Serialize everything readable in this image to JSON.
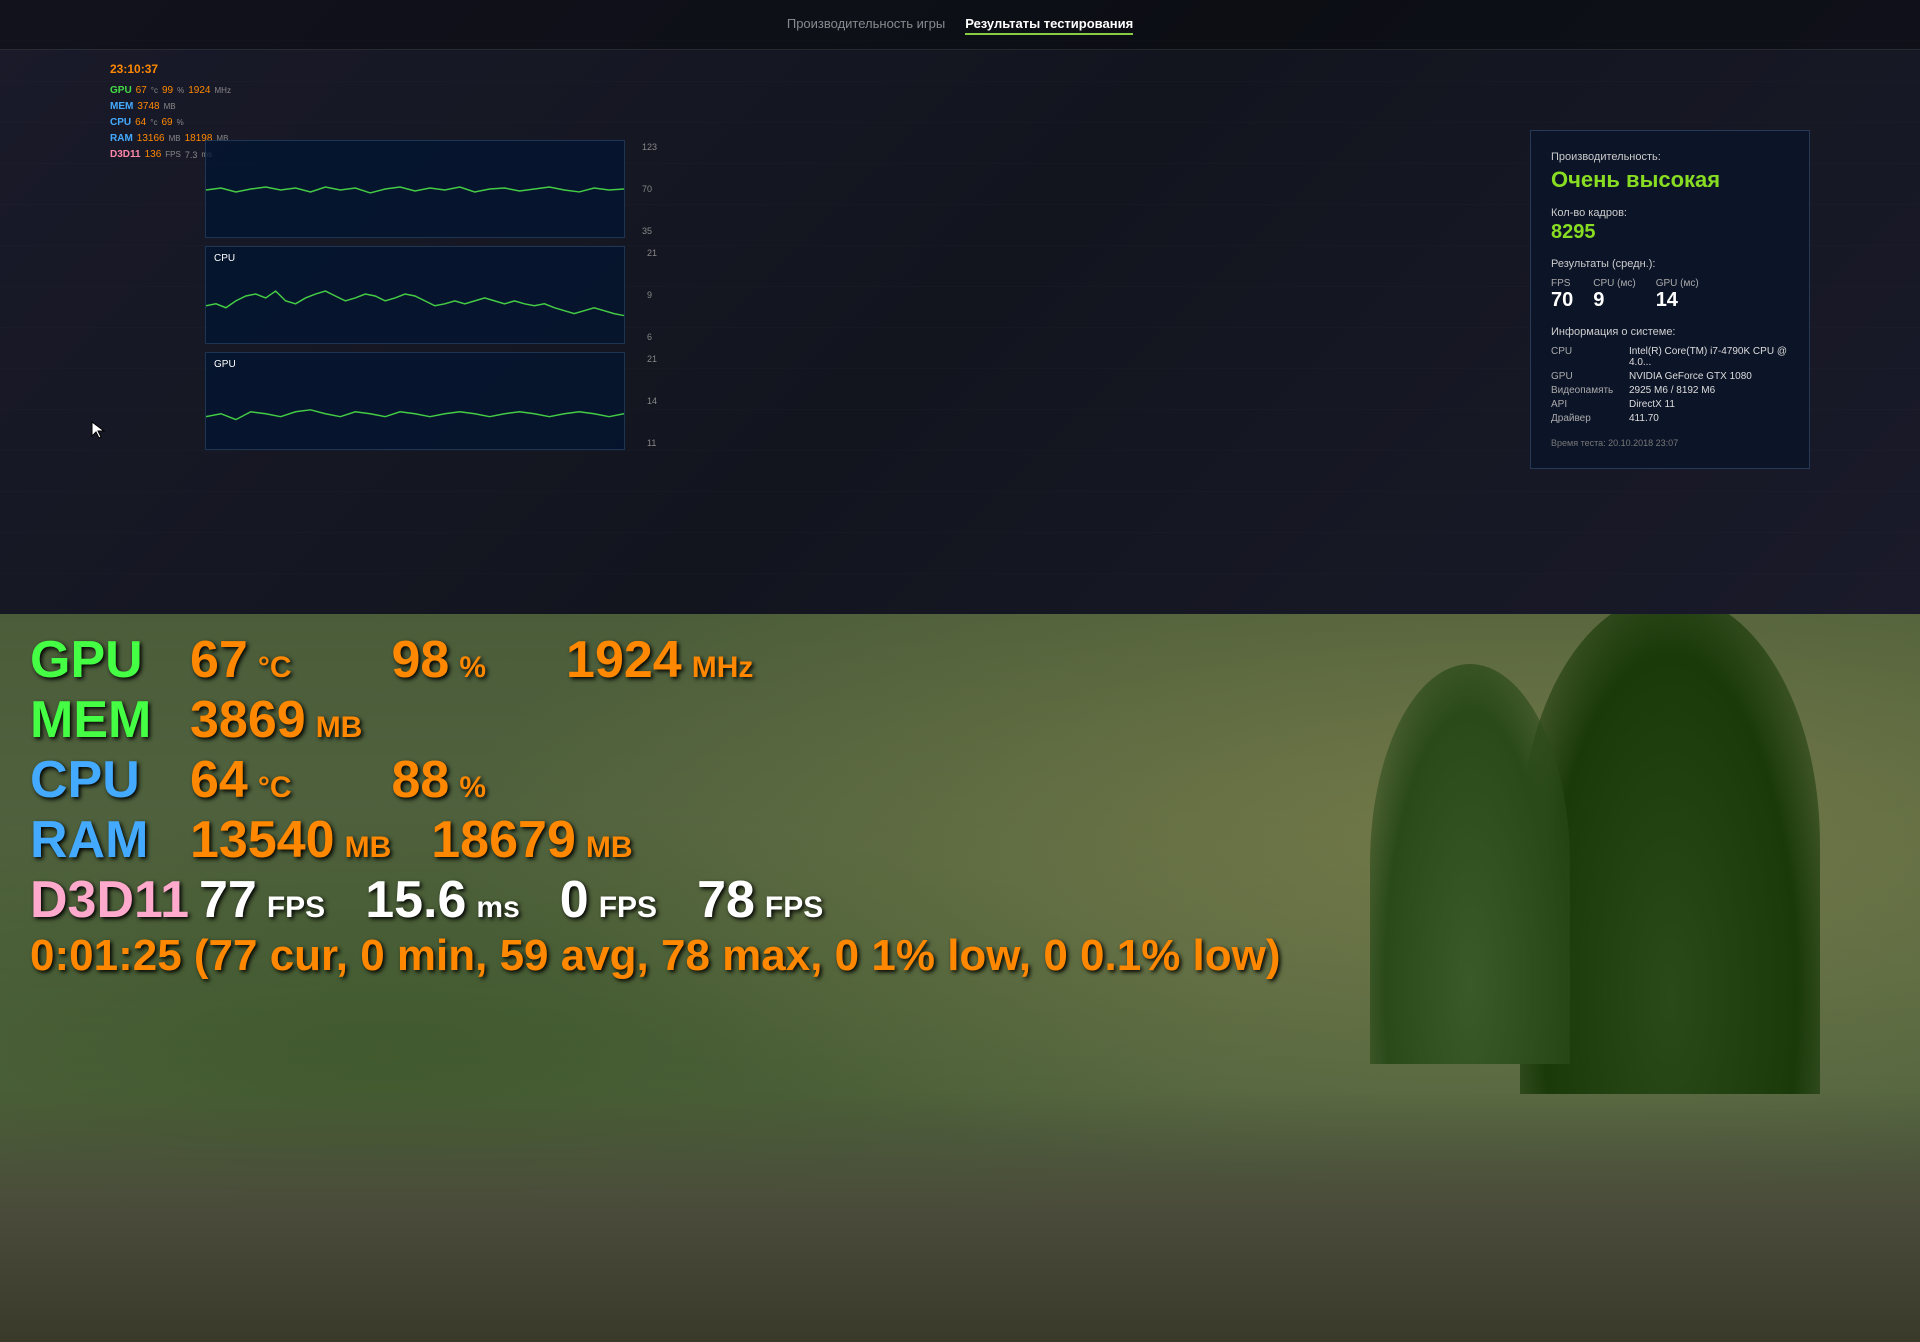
{
  "nav": {
    "tab1": "Производительность игры",
    "tab2": "Результаты тестирования"
  },
  "stats_overlay": {
    "time": "23:10:37",
    "gpu_label": "GPU",
    "gpu_temp": "67",
    "gpu_temp_unit": "°c",
    "gpu_load": "99",
    "gpu_load_unit": "%",
    "gpu_clock": "1924",
    "gpu_clock_unit": "MHz",
    "mem_label": "MEM",
    "mem_val": "3748",
    "mem_unit": "MB",
    "cpu_label": "CPU",
    "cpu_temp": "64",
    "cpu_temp_unit": "°c",
    "cpu_load": "69",
    "cpu_load_unit": "%",
    "ram_label": "RAM",
    "ram_val1": "13166",
    "ram_unit1": "MB",
    "ram_val2": "18198",
    "ram_unit2": "MB",
    "d3d_label": "D3D11",
    "d3d_fps": "136",
    "d3d_fps_unit": "FPS",
    "d3d_ms": "7.3",
    "d3d_ms_unit": "ms"
  },
  "charts": {
    "top_label": "",
    "top_scale": [
      "123",
      "70",
      "35"
    ],
    "cpu_label": "CPU",
    "cpu_scale": [
      "21",
      "9",
      "6"
    ],
    "gpu_label": "GPU",
    "gpu_scale": [
      "21",
      "14",
      "11"
    ]
  },
  "results": {
    "perf_label": "Производительность:",
    "perf_value": "Очень высокая",
    "frames_label": "Кол-во кадров:",
    "frames_value": "8295",
    "avg_label": "Результаты (средн.):",
    "fps_label": "FPS",
    "fps_value": "70",
    "cpu_ms_label": "CPU (мс)",
    "cpu_ms_value": "9",
    "gpu_ms_label": "GPU (мс)",
    "gpu_ms_value": "14",
    "sysinfo_label": "Информация о системе:",
    "cpu_key": "CPU",
    "cpu_val": "Intel(R) Core(TM) i7-4790K CPU @ 4.0...",
    "gpu_key": "GPU",
    "gpu_val": "NVIDIA GeForce GTX 1080",
    "vram_key": "Видеопамять",
    "vram_val": "2925 М6 / 8192 М6",
    "api_key": "API",
    "api_val": "DirectX 11",
    "driver_key": "Драйвер",
    "driver_val": "411.70",
    "timestamp": "Время теста: 20.10.2018 23:07"
  },
  "hud": {
    "gpu_label": "GPU",
    "gpu_temp": "67",
    "gpu_temp_unit": "°C",
    "gpu_load": "98",
    "gpu_load_unit": "%",
    "gpu_clock": "1924",
    "gpu_clock_unit": "MHz",
    "mem_label": "MEM",
    "mem_val": "3869",
    "mem_unit": "MB",
    "cpu_label": "CPU",
    "cpu_temp": "64",
    "cpu_temp_unit": "°C",
    "cpu_load": "88",
    "cpu_load_unit": "%",
    "ram_label": "RAM",
    "ram_val1": "13540",
    "ram_unit1": "MB",
    "ram_val2": "18679",
    "ram_unit2": "MB",
    "d3d_label": "D3D11",
    "d3d_fps": "77",
    "d3d_fps_unit": "FPS",
    "d3d_ms": "15.6",
    "d3d_ms_unit": "ms",
    "d3d_fps2": "0",
    "d3d_fps2_unit": "FPS",
    "d3d_fps3": "78",
    "d3d_fps3_unit": "FPS",
    "summary": "0:01:25 (77 cur, 0 min, 59 avg, 78 max, 0 1% low, 0 0.1% low)"
  }
}
